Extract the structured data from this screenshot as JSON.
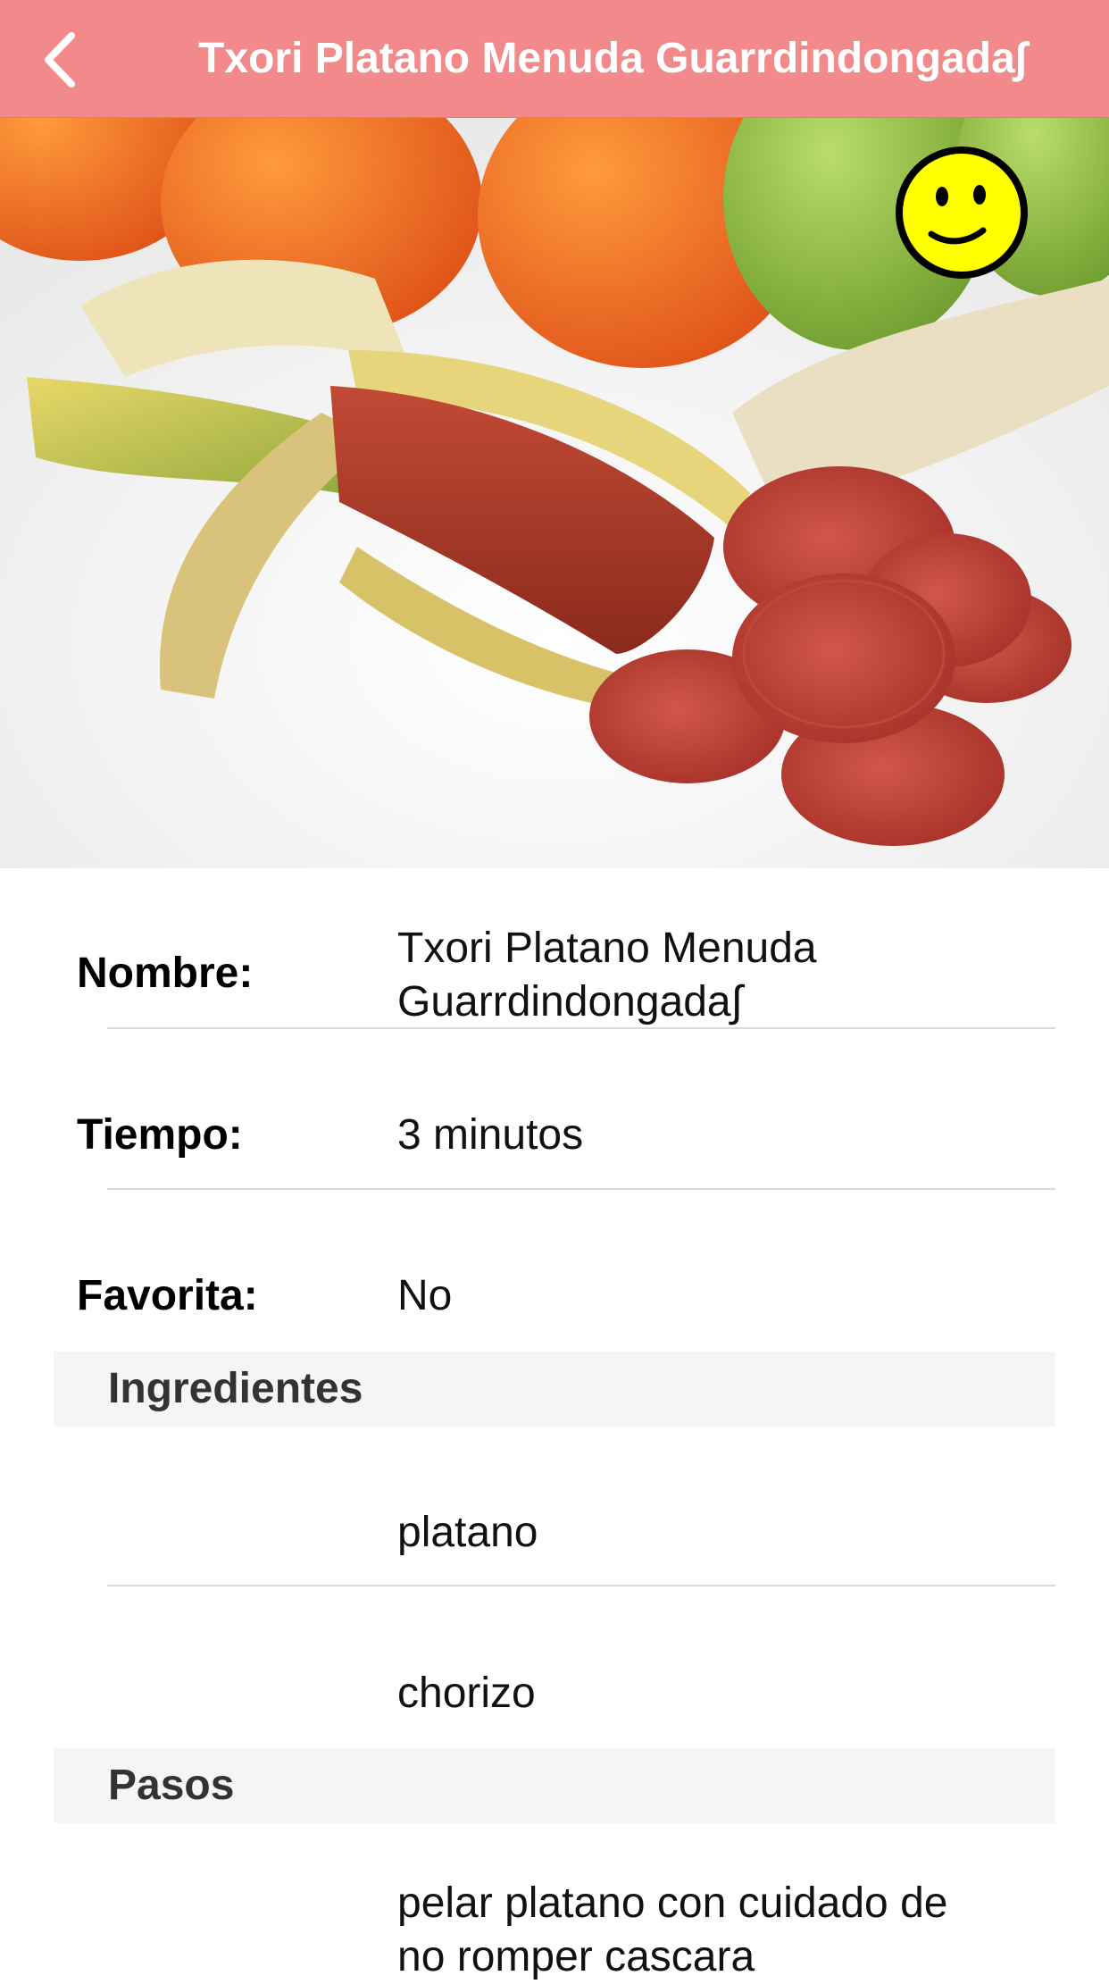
{
  "navbar": {
    "title": "Txori Platano Menuda Guarrdindongada∫",
    "back_icon": "chevron-left-icon",
    "background": "#f28a8c"
  },
  "hero": {
    "favorite_icon": "smiley-face-icon"
  },
  "details": {
    "nombre_label": "Nombre:",
    "nombre_value_line1": "Txori Platano Menuda",
    "nombre_value_line2": "Guarrdindongada∫",
    "tiempo_label": "Tiempo:",
    "tiempo_value": "3 minutos",
    "favorita_label": "Favorita:",
    "favorita_value": "No"
  },
  "ingredientes": {
    "header": "Ingredientes",
    "items": [
      "platano",
      "chorizo"
    ]
  },
  "pasos": {
    "header": "Pasos",
    "step1_line1": "pelar platano con cuidado de",
    "step1_line2": "no romper cascara"
  }
}
